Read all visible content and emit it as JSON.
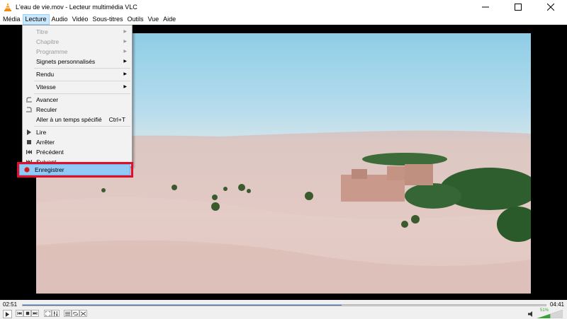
{
  "window": {
    "title": "L'eau de vie.mov - Lecteur multimédia VLC",
    "icons": [
      "vlc-cone-icon",
      "minimize-icon",
      "maximize-icon",
      "close-icon"
    ]
  },
  "menubar": {
    "items": [
      {
        "label": "Média"
      },
      {
        "label": "Lecture",
        "active": true
      },
      {
        "label": "Audio"
      },
      {
        "label": "Vidéo"
      },
      {
        "label": "Sous-titres"
      },
      {
        "label": "Outils"
      },
      {
        "label": "Vue"
      },
      {
        "label": "Aide"
      }
    ]
  },
  "playback_menu": {
    "items": [
      {
        "label": "Titre",
        "disabled": true,
        "submenu": true
      },
      {
        "label": "Chapitre",
        "disabled": true,
        "submenu": true
      },
      {
        "label": "Programme",
        "disabled": true,
        "submenu": true
      },
      {
        "label": "Signets personnalisés",
        "submenu": true
      },
      {
        "label": "Rendu",
        "submenu": true
      },
      {
        "label": "Vitesse",
        "submenu": true
      },
      {
        "label": "Avancer",
        "icon": "forward-icon"
      },
      {
        "label": "Reculer",
        "icon": "backward-icon"
      },
      {
        "label": "Aller à un temps spécifié",
        "shortcut": "Ctrl+T"
      },
      {
        "label": "Lire",
        "icon": "play-icon"
      },
      {
        "label": "Arrêter",
        "icon": "stop-icon"
      },
      {
        "label": "Précédent",
        "icon": "previous-icon"
      },
      {
        "label": "Suivant",
        "icon": "next-icon"
      },
      {
        "label": "Enregistrer",
        "icon": "record-icon",
        "highlighted": true
      }
    ]
  },
  "controls": {
    "elapsed": "02:51",
    "total": "04:41",
    "progress_fraction": 0.61,
    "volume_percent": "51%",
    "volume_level": 0.51,
    "accent_color": "#3578c6",
    "highlight_color": "#e0102a"
  }
}
